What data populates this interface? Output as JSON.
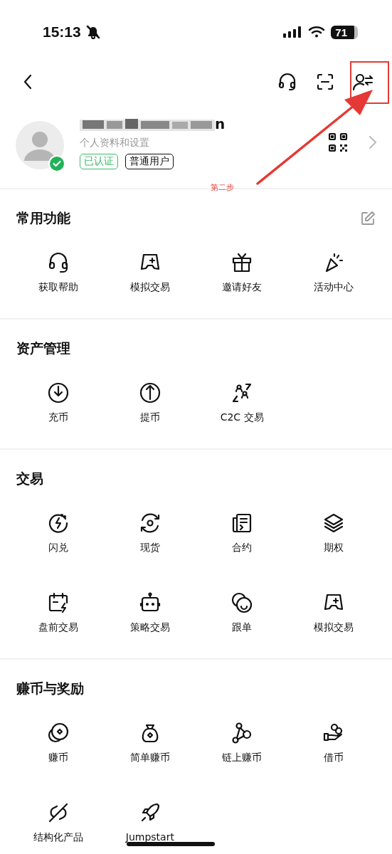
{
  "status_bar": {
    "time": "15:13",
    "muted": true,
    "battery": "71"
  },
  "profile": {
    "email_end": "n",
    "subtitle": "个人资料和设置",
    "verified": true,
    "tags": [
      {
        "label": "已认证",
        "kind": "verified"
      },
      {
        "label": "普通用户",
        "kind": "plain"
      }
    ]
  },
  "annotation": {
    "label": "第二步"
  },
  "sections": [
    {
      "title": "常用功能",
      "editable": true,
      "items": [
        {
          "label": "获取帮助"
        },
        {
          "label": "模拟交易"
        },
        {
          "label": "邀请好友"
        },
        {
          "label": "活动中心"
        }
      ]
    },
    {
      "title": "资产管理",
      "editable": false,
      "items": [
        {
          "label": "充币"
        },
        {
          "label": "提币"
        },
        {
          "label": "C2C 交易"
        }
      ]
    },
    {
      "title": "交易",
      "editable": false,
      "items": [
        {
          "label": "闪兑"
        },
        {
          "label": "现货"
        },
        {
          "label": "合约"
        },
        {
          "label": "期权"
        },
        {
          "label": "盘前交易"
        },
        {
          "label": "策略交易"
        },
        {
          "label": "跟单"
        },
        {
          "label": "模拟交易"
        }
      ]
    },
    {
      "title": "赚币与奖励",
      "editable": false,
      "items": [
        {
          "label": "赚币"
        },
        {
          "label": "简单赚币"
        },
        {
          "label": "链上赚币"
        },
        {
          "label": "借币"
        },
        {
          "label": "结构化产品"
        },
        {
          "label": "Jumpstart"
        }
      ]
    }
  ]
}
